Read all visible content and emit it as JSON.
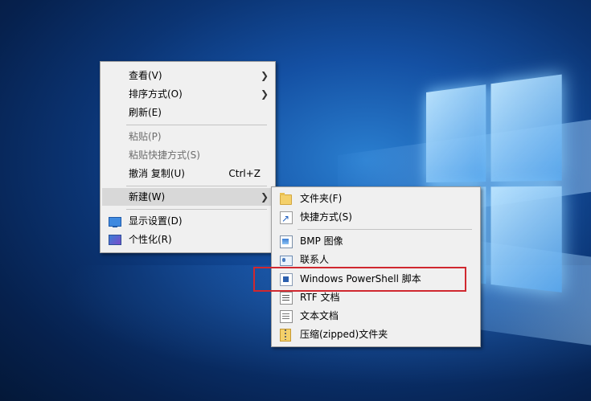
{
  "context_menu": {
    "items": [
      {
        "label": "查看(V)",
        "submenu": true
      },
      {
        "label": "排序方式(O)",
        "submenu": true
      },
      {
        "label": "刷新(E)"
      },
      {
        "label": "粘贴(P)",
        "disabled": true
      },
      {
        "label": "粘贴快捷方式(S)",
        "disabled": true
      },
      {
        "label": "撤消 复制(U)",
        "shortcut": "Ctrl+Z"
      },
      {
        "label": "新建(W)",
        "submenu": true,
        "highlighted": true
      },
      {
        "label": "显示设置(D)",
        "icon": "display-icon"
      },
      {
        "label": "个性化(R)",
        "icon": "personalize-icon"
      }
    ]
  },
  "new_submenu": {
    "items": [
      {
        "label": "文件夹(F)",
        "icon": "folder-icon"
      },
      {
        "label": "快捷方式(S)",
        "icon": "shortcut-icon"
      },
      {
        "label": "BMP 图像",
        "icon": "bmp-image-icon"
      },
      {
        "label": "联系人",
        "icon": "contact-icon"
      },
      {
        "label": "Windows PowerShell 脚本",
        "icon": "powershell-script-icon",
        "highlighted_by_annotation": true
      },
      {
        "label": "RTF 文档",
        "icon": "rtf-document-icon"
      },
      {
        "label": "文本文档",
        "icon": "text-document-icon"
      },
      {
        "label": "压缩(zipped)文件夹",
        "icon": "zip-folder-icon"
      }
    ]
  },
  "colors": {
    "menu_bg": "#f0f0f0",
    "highlight_bg": "#d8d8d8",
    "annotation_red": "#d0282f",
    "desktop_blue": "#0b3473"
  }
}
